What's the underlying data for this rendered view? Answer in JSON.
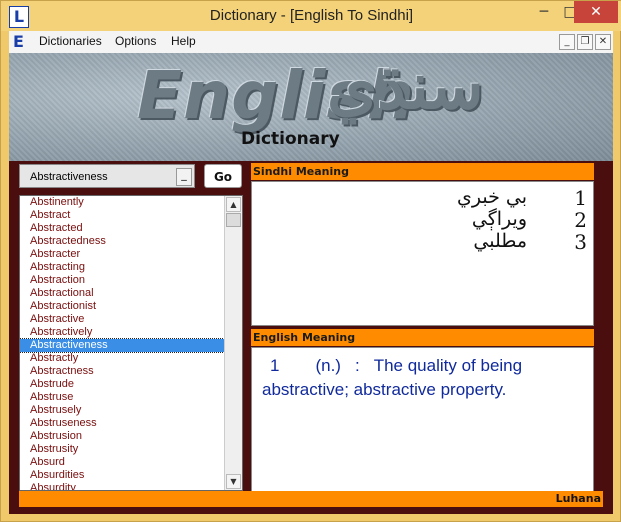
{
  "window": {
    "title": "Dictionary - [English To Sindhi]",
    "app_icon": "L",
    "minimize": "─",
    "maximize": "□",
    "close": "✕"
  },
  "menubar": {
    "icon": "E",
    "items": [
      "Dictionaries",
      "Options",
      "Help"
    ],
    "mdi_min": "_",
    "mdi_restore": "❐",
    "mdi_close": "✕"
  },
  "banner": {
    "english": "English",
    "sindhi": "سنڌي",
    "dictionary": "Dictionary"
  },
  "search": {
    "value": "Abstractiveness",
    "dropdown": "_",
    "go_label": "Go"
  },
  "word_list": {
    "items": [
      "Abstinently",
      "Abstract",
      "Abstracted",
      "Abstractedness",
      "Abstracter",
      "Abstracting",
      "Abstraction",
      "Abstractional",
      "Abstractionist",
      "Abstractive",
      "Abstractively",
      "Abstractiveness",
      "Abstractly",
      "Abstractness",
      "Abstrude",
      "Abstruse",
      "Abstrusely",
      "Abstruseness",
      "Abstrusion",
      "Abstrusity",
      "Absurd",
      "Absurdities",
      "Absurdity"
    ],
    "selected_index": 11
  },
  "sindhi_panel": {
    "header": "Sindhi Meaning",
    "meanings": [
      {
        "num": "1",
        "text": "بي خبري"
      },
      {
        "num": "2",
        "text": "ويراڳي"
      },
      {
        "num": "3",
        "text": "مطلبي"
      }
    ]
  },
  "english_panel": {
    "header": "English Meaning",
    "num": "1",
    "pos": "(n.)",
    "colon": ":",
    "text": "The quality of being abstractive; abstractive property."
  },
  "footer": {
    "label": "Luhana"
  },
  "colors": {
    "accent_orange": "#ff8c00",
    "frame_gold": "#f0c96a",
    "client_maroon": "#4a0e0e",
    "word_text": "#7a0e0e",
    "selection_blue": "#3a8ee6",
    "meaning_blue": "#102a9c"
  }
}
